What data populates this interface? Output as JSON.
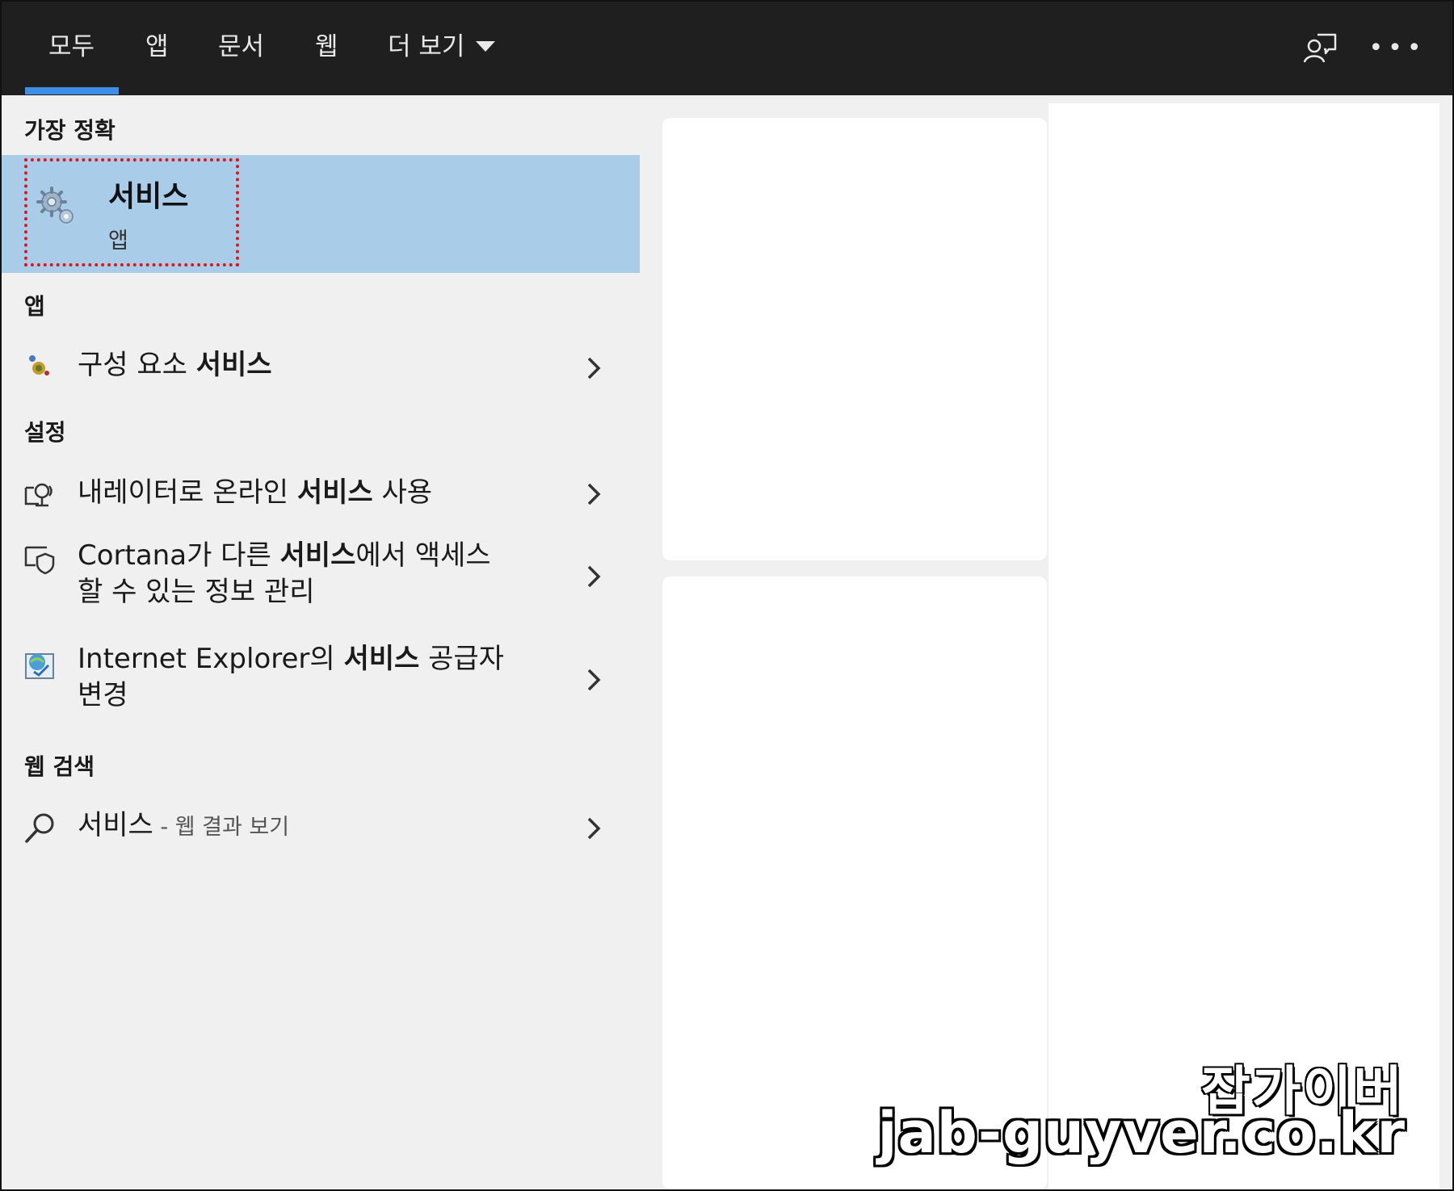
{
  "tabs": {
    "all": "모두",
    "apps": "앱",
    "documents": "문서",
    "web": "웹",
    "more": "더 보기"
  },
  "sections": {
    "best_match": "가장 정확",
    "apps": "앱",
    "settings": "설정",
    "web_search": "웹 검색"
  },
  "best_match": {
    "title": "서비스",
    "subtitle": "앱"
  },
  "apps": [
    {
      "prefix": "구성 요소 ",
      "bold": "서비스",
      "suffix": ""
    }
  ],
  "settings": [
    {
      "line1_prefix": "내레이터로 온라인 ",
      "line1_bold": "서비스",
      "line1_suffix": " 사용",
      "line2": ""
    },
    {
      "line1_prefix": "Cortana가 다른 ",
      "line1_bold": "서비스",
      "line1_suffix": "에서 액세스",
      "line2": "할 수 있는 정보 관리"
    },
    {
      "line1_prefix": "Internet Explorer의 ",
      "line1_bold": "서비스",
      "line1_suffix": " 공급자",
      "line2": "변경"
    }
  ],
  "web_search": {
    "query": "서비스",
    "hint": " - 웹 결과 보기"
  },
  "watermark": {
    "korean": "잡가이버",
    "url": "jab-guyver.co.kr"
  },
  "colors": {
    "topbar": "#1f1f1f",
    "tab_underline": "#3d8ee6",
    "selected_row": "#a9cce9",
    "highlight_border": "#e0141e"
  }
}
